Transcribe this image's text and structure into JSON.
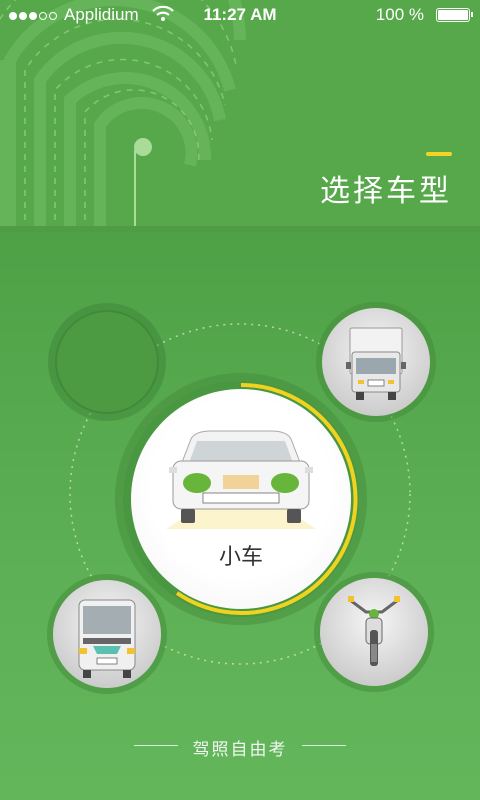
{
  "status_bar": {
    "carrier": "Applidium",
    "time": "11:27 AM",
    "battery": "100 %"
  },
  "header": {
    "title": "选择车型"
  },
  "vehicles": {
    "selected": {
      "label": "小车",
      "icon": "car-icon"
    },
    "truck": {
      "icon": "truck-icon"
    },
    "bus": {
      "icon": "bus-icon"
    },
    "motorcycle": {
      "icon": "motorcycle-icon"
    },
    "empty": {
      "icon": "empty-slot"
    }
  },
  "footer": {
    "text": "驾照自由考"
  },
  "colors": {
    "background": "#5aa84e",
    "accent": "#f5d323",
    "selected_ring": "#f1d31f"
  }
}
